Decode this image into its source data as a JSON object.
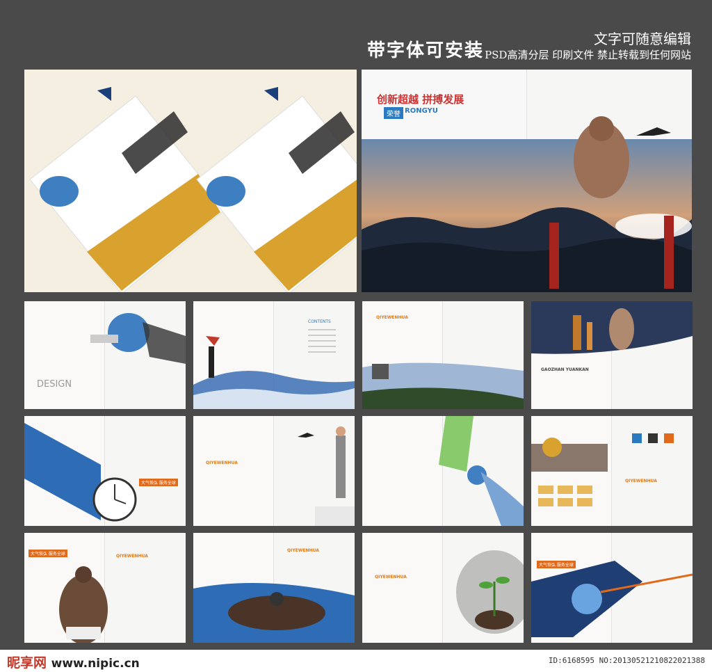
{
  "header": {
    "left_slogan": "带字体可安装",
    "right_line1": "文字可随意编辑",
    "right_line2": "PSD高清分层 印刷文件 禁止转载到任何网站"
  },
  "hero": {
    "slogan": "创新超越 拼搏发展",
    "brand": "RONGYU",
    "brand_label": "荣誉"
  },
  "pages": {
    "design": "DESIGN",
    "contents": "CONTENTS",
    "qiyewenhua": "QIYEWENHUA",
    "rongyu": "RONGYU",
    "gaoshan": "GAOZHAN YUANKAN",
    "dadu": "大气恢弘 服务全球"
  },
  "footer": {
    "logo": "昵享网",
    "url": "www.nipic.cn",
    "id": "ID:6168595 NO:20130521210822021388"
  }
}
